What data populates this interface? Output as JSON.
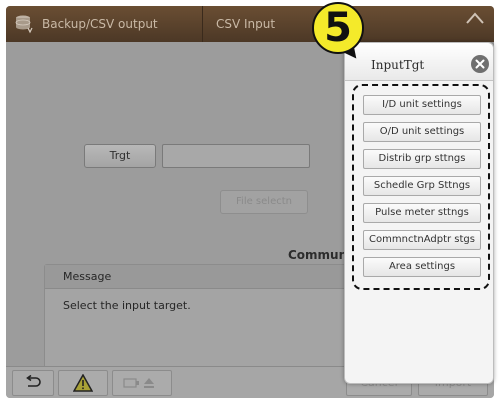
{
  "header": {
    "tab_backup": "Backup/CSV output",
    "tab_csv": "CSV Input"
  },
  "form": {
    "target_button": "Trgt",
    "target_value": "",
    "file_select_button": "File selectn",
    "communication_label": "Communicat"
  },
  "message": {
    "header": "Message",
    "text": "Select the input target."
  },
  "footer": {
    "cancel_button": "Cancel",
    "import_button": "Import"
  },
  "panel": {
    "title": "InputTgt",
    "options": [
      "I/D unit settings",
      "O/D unit settings",
      "Distrib grp sttngs",
      "Schedle Grp Sttngs",
      "Pulse meter sttngs",
      "CommnctnAdptr stgs",
      "Area settings"
    ]
  },
  "annotation": {
    "step_number": "5"
  },
  "colors": {
    "badge_yellow": "#f4ea2a",
    "titlebar_brown": "#5a4330",
    "dim_gray": "#9c9c9c"
  }
}
